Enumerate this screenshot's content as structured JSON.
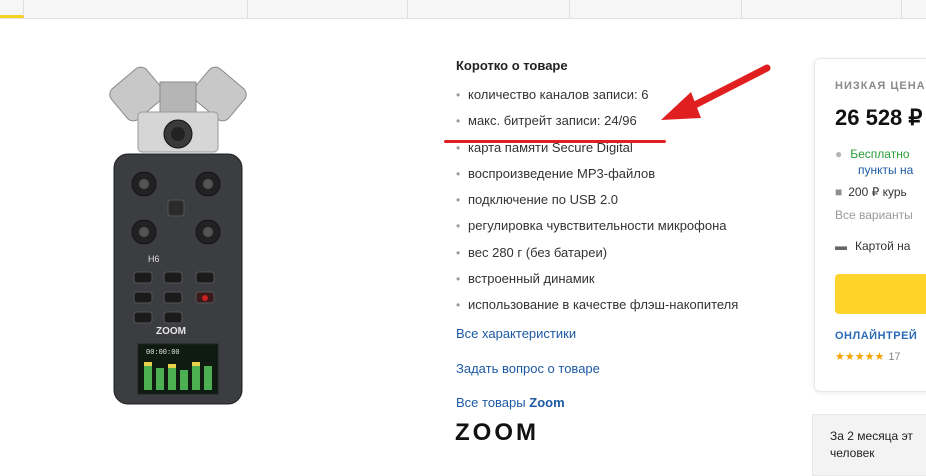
{
  "specs": {
    "title": "Коротко о товаре",
    "items": [
      "количество каналов записи: 6",
      "макс. битрейт записи: 24/96",
      "карта памяти Secure Digital",
      "воспроизведение MP3-файлов",
      "подключение по USB 2.0",
      "регулировка чувствительности микрофона",
      "вес 280 г (без батареи)",
      "встроенный динамик",
      "использование в качестве флэш-накопителя"
    ],
    "all_specs_link": "Все характеристики",
    "ask_question_link": "Задать вопрос о товаре",
    "all_goods_prefix": "Все товары",
    "all_goods_brand": "Zoom"
  },
  "brand_logo_text": "ZOOM",
  "device": {
    "model_label": "H6",
    "brand_label": "ZOOM",
    "screen_time": "00:00:00"
  },
  "offer": {
    "low_price_label": "НИЗКАЯ ЦЕНА",
    "price": "26 528 ₽",
    "delivery_free": "Бесплатно",
    "delivery_points": "пункты на",
    "delivery_courier": "200 ₽ курь",
    "delivery_variants": "Все варианты",
    "payment": "Картой на",
    "shop_name": "ОНЛАЙНТРЕЙ",
    "rating_stars": "★★★★★",
    "rating_count": "17",
    "note_line1": "За 2 месяца эт",
    "note_line2": "человек"
  },
  "colors": {
    "link": "#1d5aa3",
    "annotation": "#e02020",
    "accent_yellow": "#fed42b",
    "free_green": "#2a9d39"
  }
}
